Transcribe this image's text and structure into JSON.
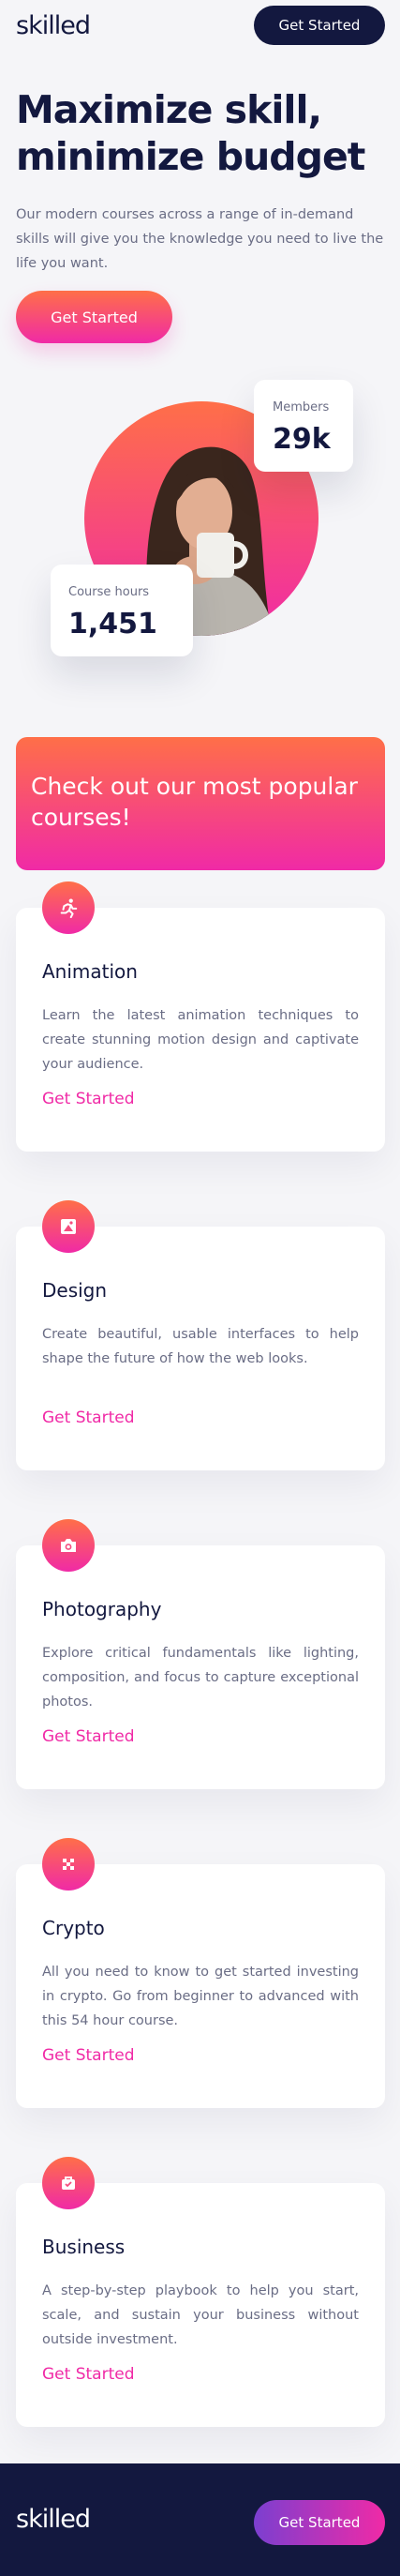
{
  "header": {
    "logo": "skilled",
    "cta_label": "Get Started"
  },
  "hero": {
    "title": "Maximize skill, minimize budget",
    "text": "Our modern courses across a range of in-demand skills will give you the knowledge you need to live the life you want.",
    "cta_label": "Get Started"
  },
  "stats": {
    "members": {
      "label": "Members",
      "value": "29k"
    },
    "hours": {
      "label": "Course hours",
      "value": "1,451"
    }
  },
  "promo": {
    "text": "Check out our most popular courses!"
  },
  "courses": [
    {
      "icon": "running-person-icon",
      "title": "Animation",
      "description": "Learn the latest animation techniques to create stunning motion design and captivate your audience.",
      "link": "Get Started"
    },
    {
      "icon": "design-icon",
      "title": "Design",
      "description": "Create beautiful, usable interfaces to help shape the future of how the web looks.",
      "link": "Get Started"
    },
    {
      "icon": "camera-icon",
      "title": "Photography",
      "description": "Explore critical fundamentals like lighting, composition, and focus to capture exceptional photos.",
      "link": "Get Started"
    },
    {
      "icon": "crypto-icon",
      "title": "Crypto",
      "description": "All you need to know to get started investing in crypto. Go from beginner to advanced with this 54 hour course.",
      "link": "Get Started"
    },
    {
      "icon": "briefcase-icon",
      "title": "Business",
      "description": "A step-by-step playbook to help you start, scale, and sustain your business without outside investment.",
      "link": "Get Started"
    }
  ],
  "footer": {
    "logo": "skilled",
    "cta_label": "Get Started"
  },
  "colors": {
    "navy": "#13183f",
    "gradient_start": "#ff6f48",
    "gradient_end": "#f02aa6",
    "text_muted": "#6a6d85"
  }
}
